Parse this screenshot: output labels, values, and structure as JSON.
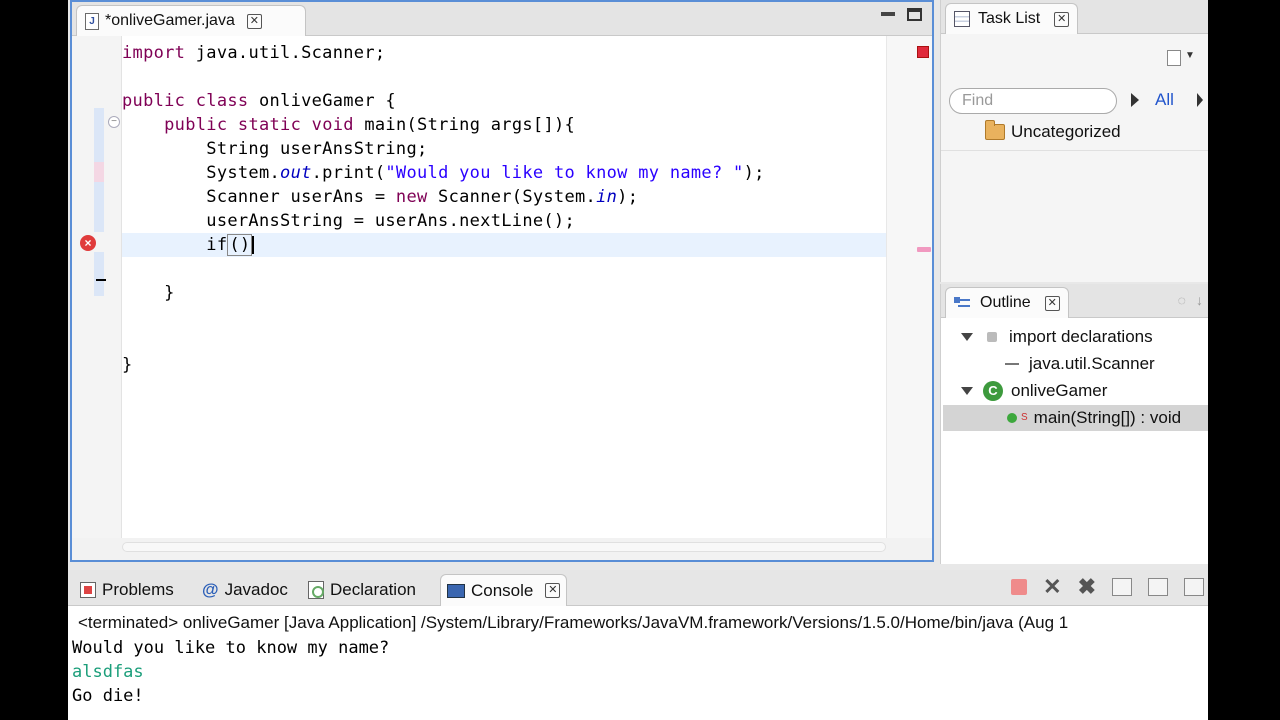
{
  "editor": {
    "tab_title": "*onliveGamer.java",
    "code_lines": [
      "import java.util.Scanner;",
      "",
      "public class onliveGamer {",
      "    public static void main(String args[]){",
      "        String userAnsString;",
      "        System.out.print(\"Would you like to know my name? \");",
      "        Scanner userAns = new Scanner(System.in);",
      "        userAnsString = userAns.nextLine();",
      "        if()",
      "",
      "    }",
      "",
      "",
      "}"
    ]
  },
  "tasklist": {
    "title": "Task List",
    "find_placeholder": "Find",
    "all_label": "All",
    "category": "Uncategorized"
  },
  "outline": {
    "title": "Outline",
    "items": [
      {
        "label": "import declarations"
      },
      {
        "label": "java.util.Scanner"
      },
      {
        "label": "onliveGamer"
      },
      {
        "label": "main(String[]) : void"
      }
    ]
  },
  "bottom": {
    "tabs": [
      {
        "label": "Problems"
      },
      {
        "label": "Javadoc"
      },
      {
        "label": "Declaration"
      },
      {
        "label": "Console"
      }
    ],
    "console_header": "<terminated> onliveGamer [Java Application] /System/Library/Frameworks/JavaVM.framework/Versions/1.5.0/Home/bin/java (Aug 1",
    "console_lines": [
      {
        "text": "Would you like to know my name?",
        "type": "output"
      },
      {
        "text": "alsdfas",
        "type": "input"
      },
      {
        "text": "Go die!",
        "type": "output"
      }
    ]
  },
  "colors": {
    "keyword": "#7f0055",
    "string": "#2a00ff",
    "console_input": "#1b9e7a",
    "active_border": "#5a8ed6"
  }
}
